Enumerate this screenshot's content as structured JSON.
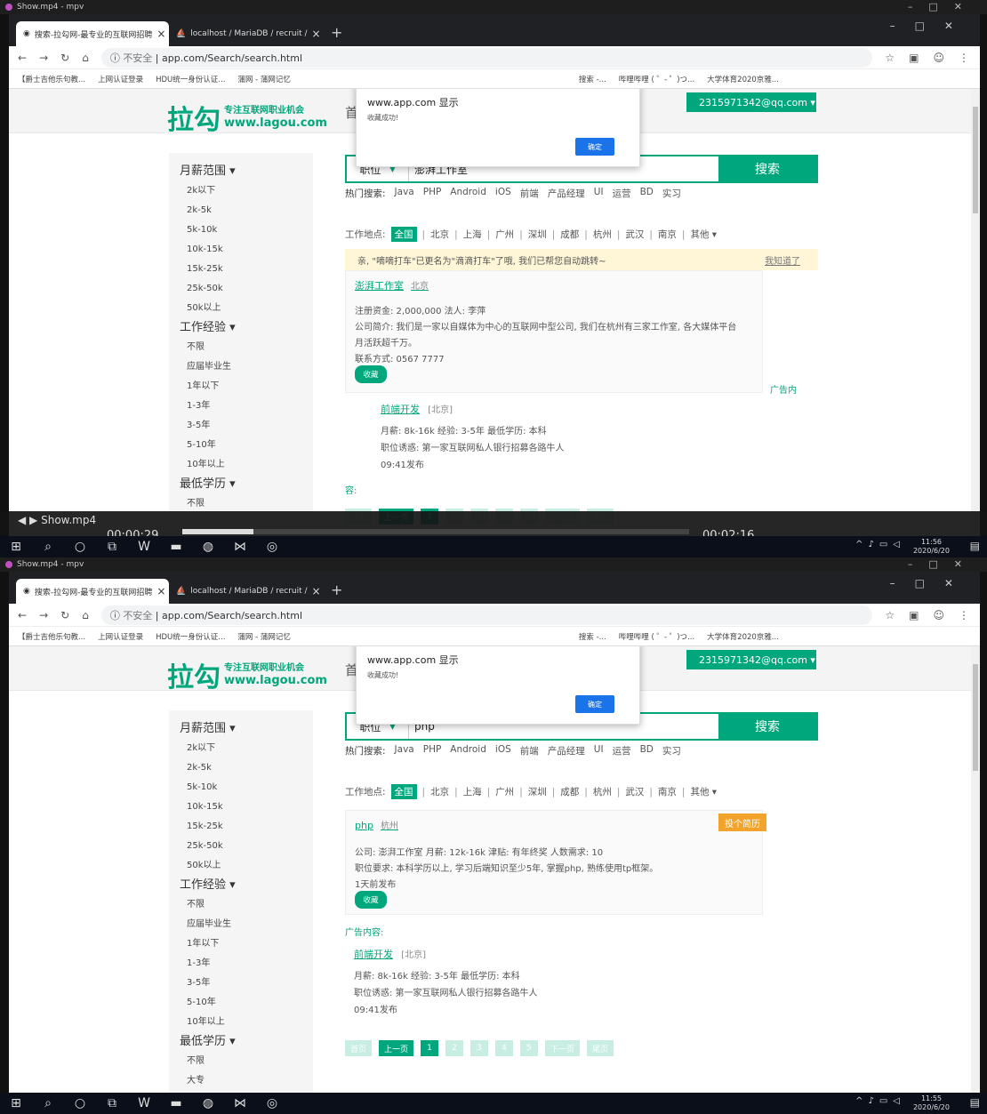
{
  "player": {
    "title": "Show.mp4 - mpv",
    "filename": "Show.mp4",
    "time_cur": "00:00:29",
    "time_total": "00:02:16"
  },
  "browser": {
    "tabs": [
      {
        "label": "搜索-拉勾网-最专业的互联网招聘"
      },
      {
        "label": "localhost / MariaDB / recruit /"
      }
    ],
    "insecure": "不安全",
    "url": "app.com/Search/search.html",
    "bookmarks": [
      "【爵士吉他乐句教...",
      "上网认证登录",
      "HDU统一身份认证...",
      "蒲网 - 蒲网记忆",
      "搜索 -...",
      "哔哩哔哩 ( ゜- ゜)つ...",
      "大学体育2020京雅..."
    ]
  },
  "dialog": {
    "title": "www.app.com 显示",
    "message": "收藏成功!",
    "ok": "确定"
  },
  "site": {
    "logo": "拉勾",
    "slogan": "专注互联网职业机会",
    "domain": "www.lagou.com",
    "nav_cut": "首",
    "user": "2315971342@qq.com ▾"
  },
  "sidebar": {
    "salary": {
      "title": "月薪范围 ▾",
      "items": [
        "2k以下",
        "2k-5k",
        "5k-10k",
        "10k-15k",
        "15k-25k",
        "25k-50k",
        "50k以上"
      ]
    },
    "exp": {
      "title": "工作经验 ▾",
      "items": [
        "不限",
        "应届毕业生",
        "1年以下",
        "1-3年",
        "3-5年",
        "5-10年",
        "10年以上"
      ]
    },
    "edu": {
      "title": "最低学历 ▾",
      "items": [
        "不限",
        "大专"
      ]
    }
  },
  "search": {
    "category": "职位",
    "query1": "澎湃工作室",
    "query2": "php",
    "button": "搜索",
    "hot_label": "热门搜索:",
    "hot": [
      "Java",
      "PHP",
      "Android",
      "iOS",
      "前端",
      "产品经理",
      "UI",
      "运营",
      "BD",
      "实习"
    ],
    "loc_label": "工作地点:",
    "locations": [
      "全国",
      "北京",
      "上海",
      "广州",
      "深圳",
      "成都",
      "杭州",
      "武汉",
      "南京",
      "其他 ▾"
    ]
  },
  "tip": {
    "text": "亲, \"嘀嘀打车\"已更名为\"滴滴打车\"了哦, 我们已帮您自动跳转~",
    "dismiss": "我知道了"
  },
  "company": {
    "name": "澎湃工作室",
    "city": "北京",
    "capital": "注册资金: 2,000,000   法人: 李萍",
    "intro1": "公司简介: 我们是一家以自媒体为中心的互联网中型公司, 我们在杭州有三家工作室, 各大媒体平台",
    "intro2": "月活跃超千万。",
    "contact": "联系方式: 0567 7777",
    "fav": "收藏",
    "ad_side": "广告内"
  },
  "frontend_job": {
    "title": "前端开发",
    "city": "[北京]",
    "line1": "月薪: 8k-16k   经验: 3-5年   最低学历: 本科",
    "line2": "职位诱惑: 第一家互联网私人银行招募各路牛人",
    "posted": "09:41发布"
  },
  "ad_cut": "容:",
  "ad_label": "广告内容:",
  "php_job": {
    "title": "php",
    "city": "杭州",
    "apply": "投个简历",
    "line1": "公司: 澎湃工作室   月薪: 12k-16k   津贴: 有年终奖   人数需求: 10",
    "line2": "职位要求: 本科学历以上, 学习后端知识至少5年, 掌握php, 熟练使用tp框架。",
    "posted": "1天前发布",
    "fav": "收藏"
  },
  "pager": [
    "首页",
    "上一页",
    "1",
    "2",
    "3",
    "4",
    "5",
    "下一页",
    "尾页"
  ],
  "taskbar": {
    "time1": "11:56",
    "date1": "2020/6/20",
    "time2": "11:55",
    "date2": "2020/6/20"
  }
}
